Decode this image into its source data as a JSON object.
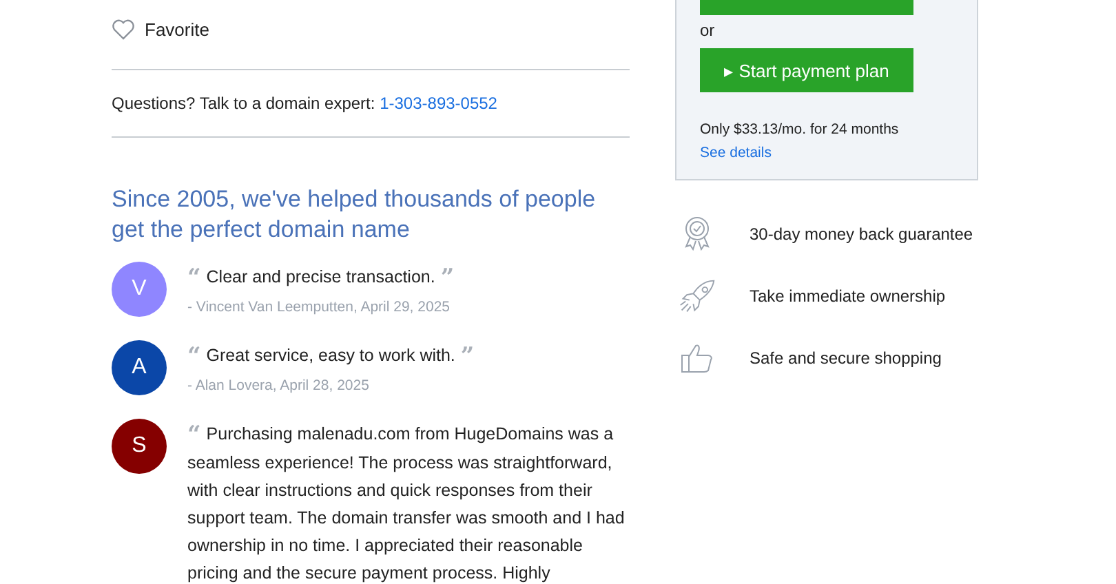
{
  "favorite": {
    "label": "Favorite",
    "selected": false
  },
  "contact": {
    "text": "Questions? Talk to a domain expert:",
    "phone": "1-303-893-0552"
  },
  "heading": "Since 2005, we've helped thousands of people get the perfect domain name",
  "reviews": [
    {
      "initial": "V",
      "color": "#8f86ff",
      "open_quote": "“",
      "text": "Clear and precise transaction.",
      "close_quote": "”",
      "author": "- Vincent Van Leemputten, April 29, 2025"
    },
    {
      "initial": "A",
      "color": "#0b47a8",
      "open_quote": "“",
      "text": "Great service, easy to work with.",
      "close_quote": "”",
      "author": "- Alan Lovera, April 28, 2025"
    },
    {
      "initial": "S",
      "color": "#850000",
      "open_quote": "“",
      "text": "Purchasing malenadu.com from HugeDomains was a seamless experience! The process was straightforward, with clear instructions and quick responses from their support team. The domain transfer was smooth and I had ownership in no time. I appreciated their reasonable pricing and the secure payment process. Highly"
    }
  ],
  "purchase": {
    "or": "or",
    "plan_button": "▸ Start payment plan",
    "plan_note": "Only $33.13/mo. for 24 months",
    "details_link": "See details"
  },
  "features": [
    {
      "kind": "award",
      "label": "30-day money back guarantee"
    },
    {
      "kind": "rocket",
      "label": "Take immediate ownership"
    },
    {
      "kind": "thumb",
      "label": "Safe and secure shopping"
    }
  ]
}
